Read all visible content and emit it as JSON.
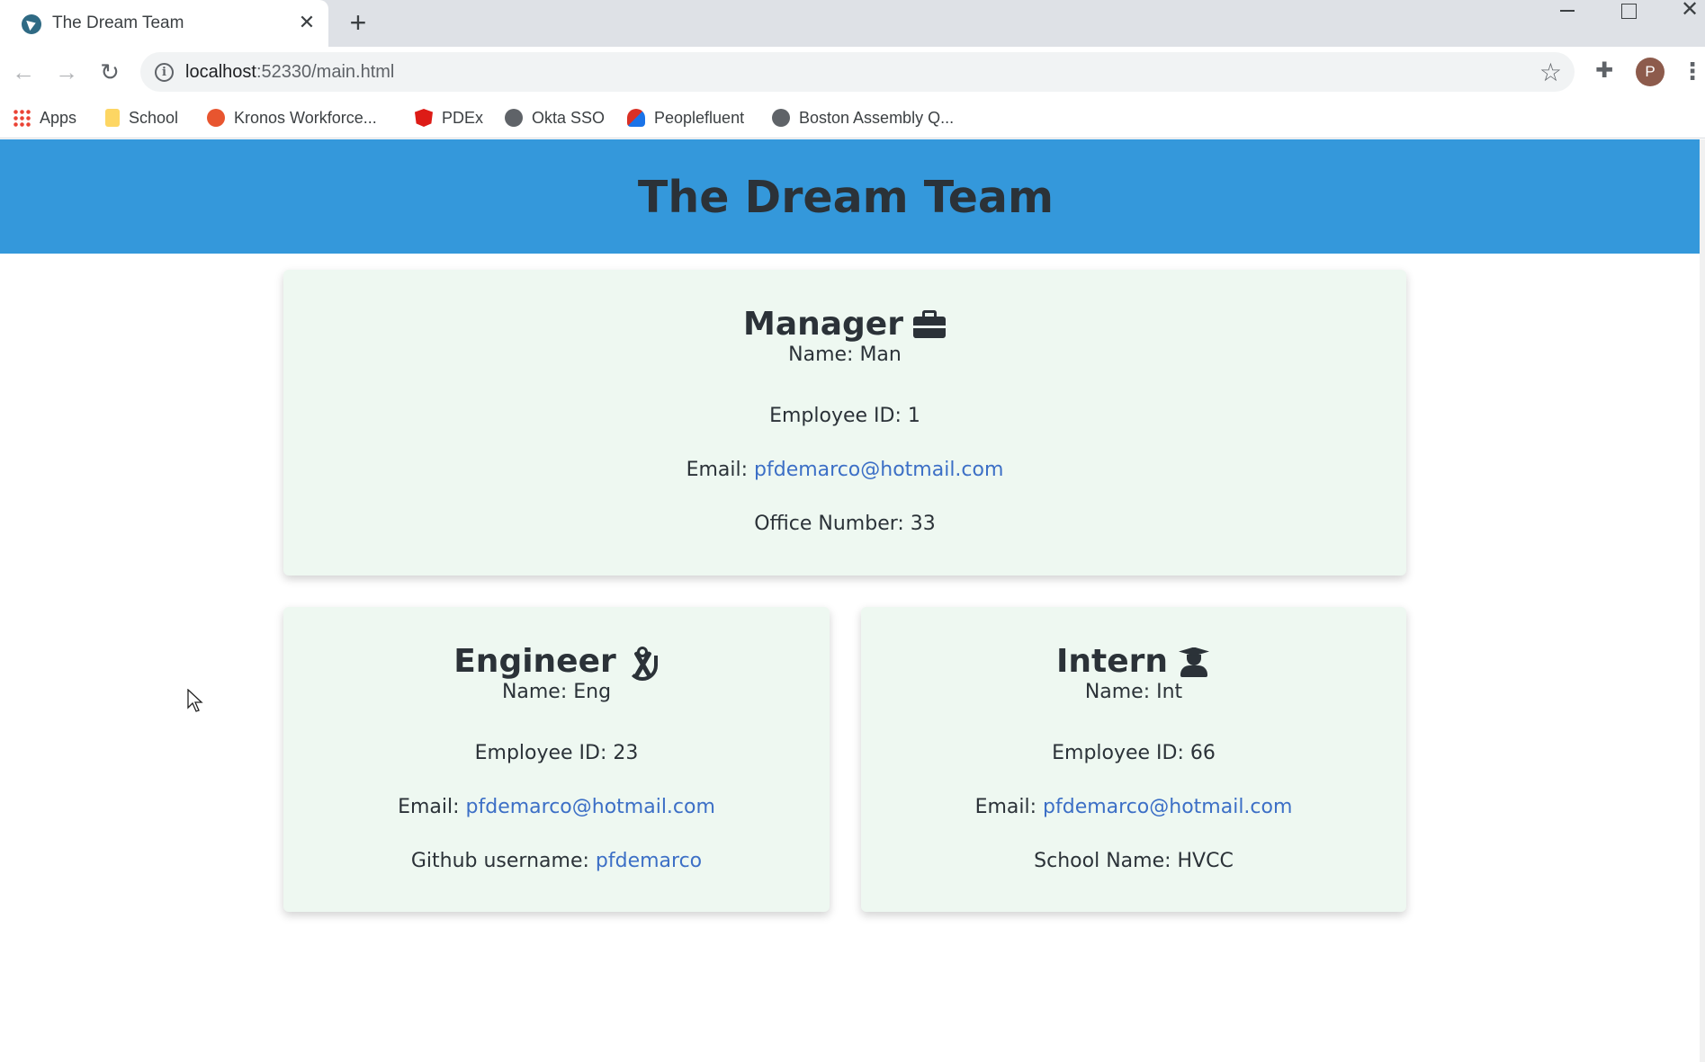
{
  "browser": {
    "tab_title": "The Dream Team",
    "tab_close": "✕",
    "new_tab": "+",
    "url_host": "localhost",
    "url_path": ":52330/main.html",
    "avatar_letter": "P",
    "bookmarks": [
      {
        "label": "Apps",
        "icon": "apps-grid-icon"
      },
      {
        "label": "School",
        "icon": "folder-icon"
      },
      {
        "label": "Kronos Workforce...",
        "icon": "kronos-icon"
      },
      {
        "label": "PDEx",
        "icon": "angular-icon"
      },
      {
        "label": "Okta SSO",
        "icon": "globe-icon"
      },
      {
        "label": "Peoplefluent",
        "icon": "peoplefluent-icon"
      },
      {
        "label": "Boston Assembly Q...",
        "icon": "globe-icon"
      }
    ]
  },
  "page": {
    "title": "The Dream Team"
  },
  "manager": {
    "role": "Manager",
    "icon": "briefcase-icon",
    "name": "Name: Man",
    "employee_id": "Employee ID: 1",
    "email_label": "Email: ",
    "email": "pfdemarco@hotmail.com",
    "office": "Office Number: 33"
  },
  "engineer": {
    "role": "Engineer",
    "icon": "drafting-compass-icon",
    "name": "Name: Eng",
    "employee_id": "Employee ID: 23",
    "email_label": "Email: ",
    "email": "pfdemarco@hotmail.com",
    "github_label": "Github username: ",
    "github": "pfdemarco"
  },
  "intern": {
    "role": "Intern",
    "icon": "user-graduate-icon",
    "name": "Name: Int",
    "employee_id": "Employee ID: 66",
    "email_label": "Email: ",
    "email": "pfdemarco@hotmail.com",
    "school": "School Name: HVCC"
  },
  "colors": {
    "header_bg": "#3498db",
    "card_bg": "#eef8f1",
    "link": "#3c6fc6"
  }
}
